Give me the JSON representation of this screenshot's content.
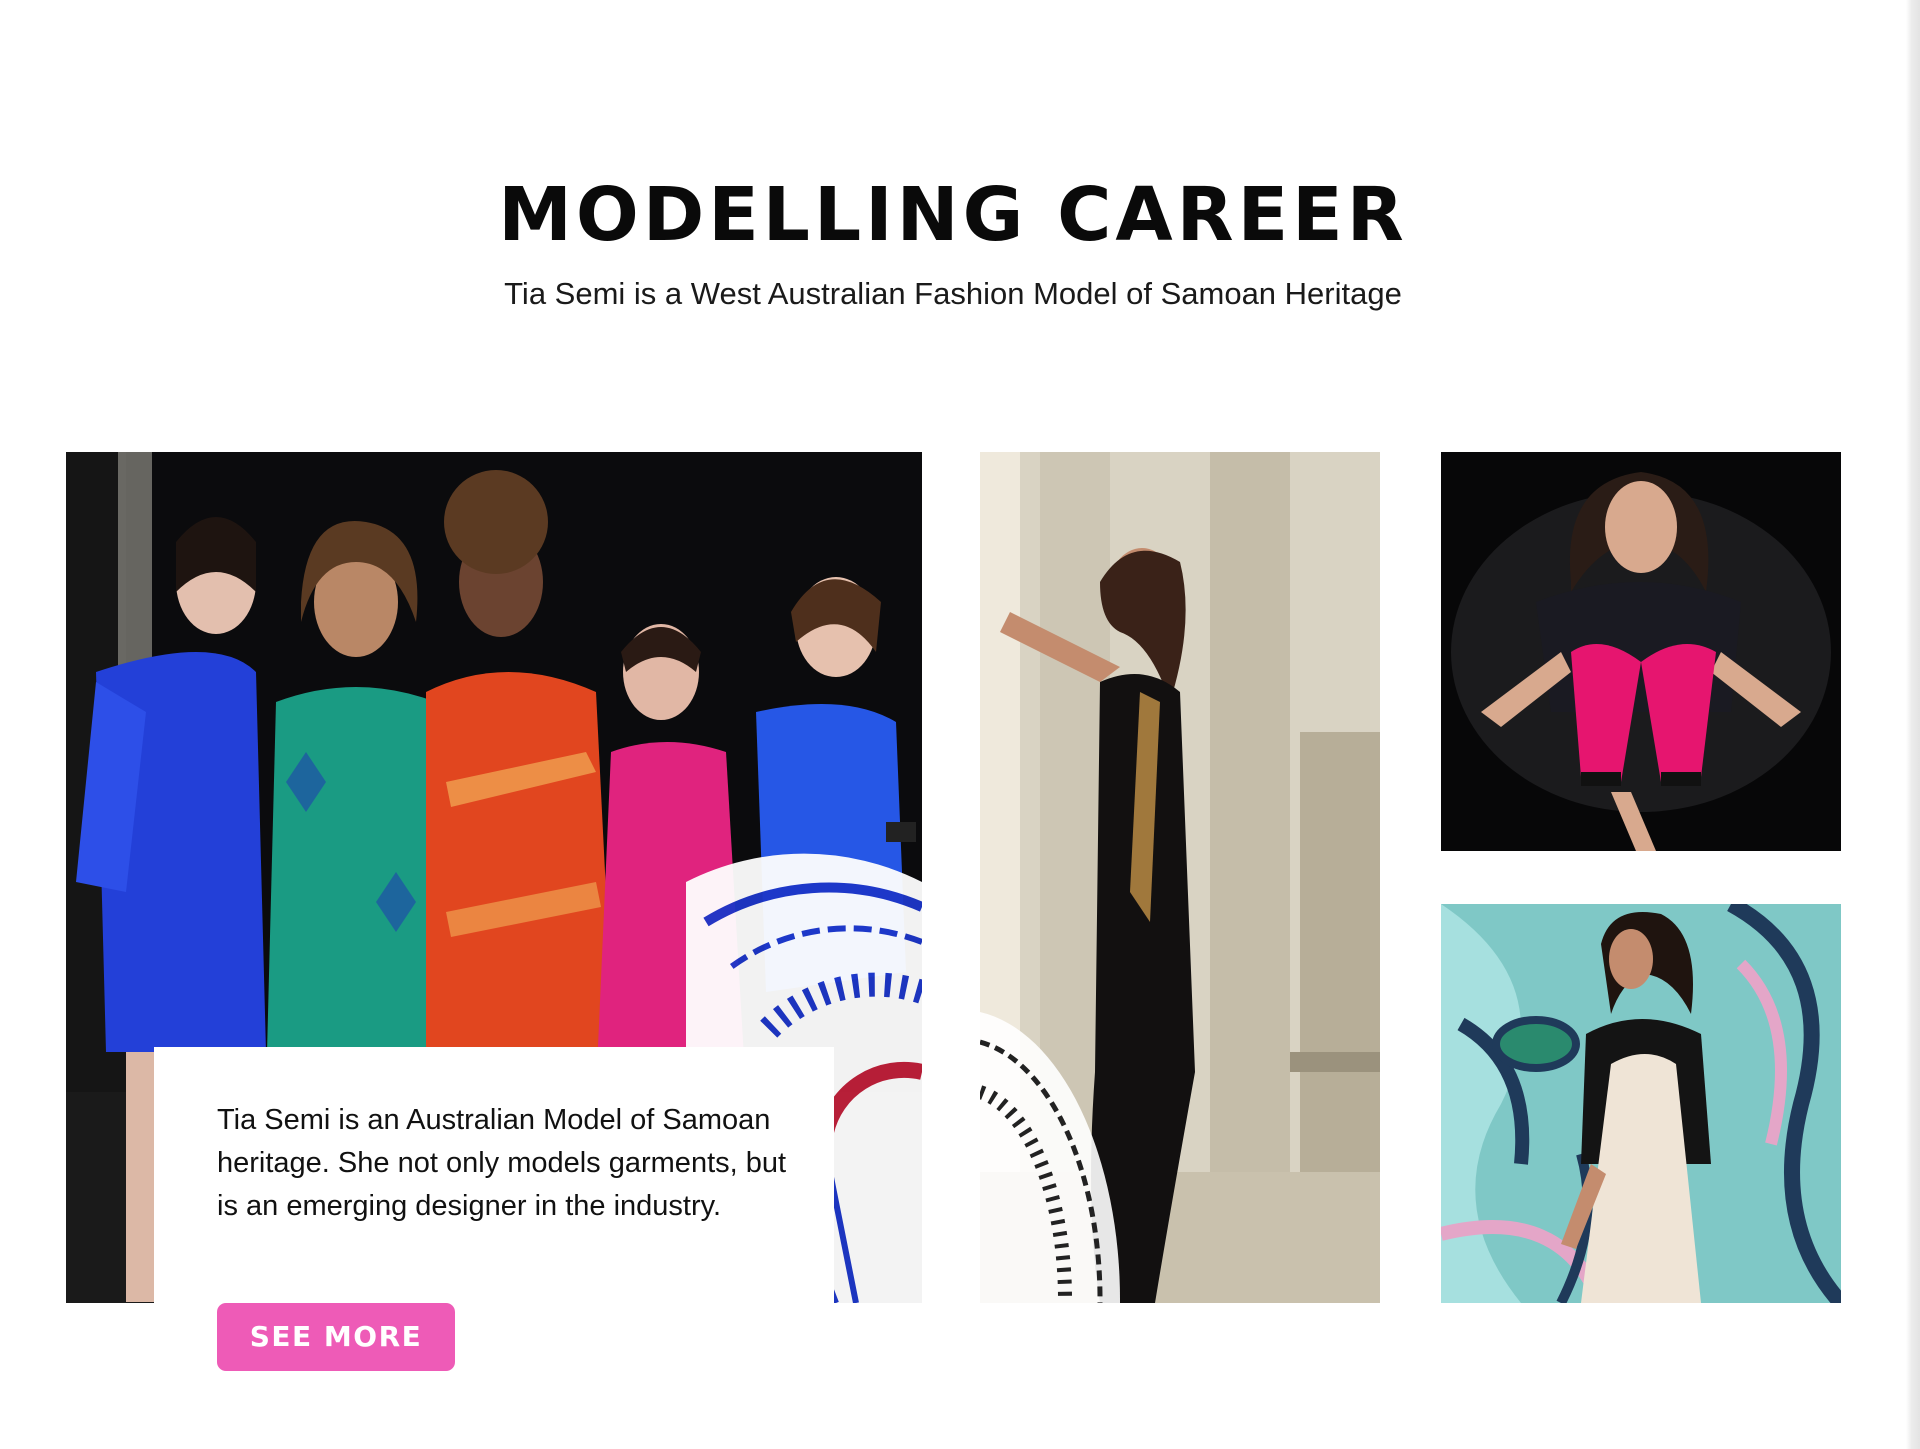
{
  "section": {
    "title": "MODELLING CAREER",
    "subtitle": "Tia Semi is a West Australian  Fashion Model of Samoan Heritage"
  },
  "feature_card": {
    "text": "Tia Semi is an Australian Model of Samoan heritage. She not only models garments, but is an emerging designer in the industry.",
    "button_label": "SEE MORE"
  },
  "colors": {
    "accent": "#ee5bb7",
    "title": "#0a0a0a",
    "background": "#ffffff"
  },
  "gallery": [
    {
      "name": "group-photo",
      "description_icon": "photo-group-of-five-models"
    },
    {
      "name": "black-gown-photo",
      "description_icon": "photo-model-in-black-gown"
    },
    {
      "name": "pink-pants-photo",
      "description_icon": "photo-model-in-pink-pants"
    },
    {
      "name": "mural-photo",
      "description_icon": "photo-model-by-mural"
    }
  ]
}
